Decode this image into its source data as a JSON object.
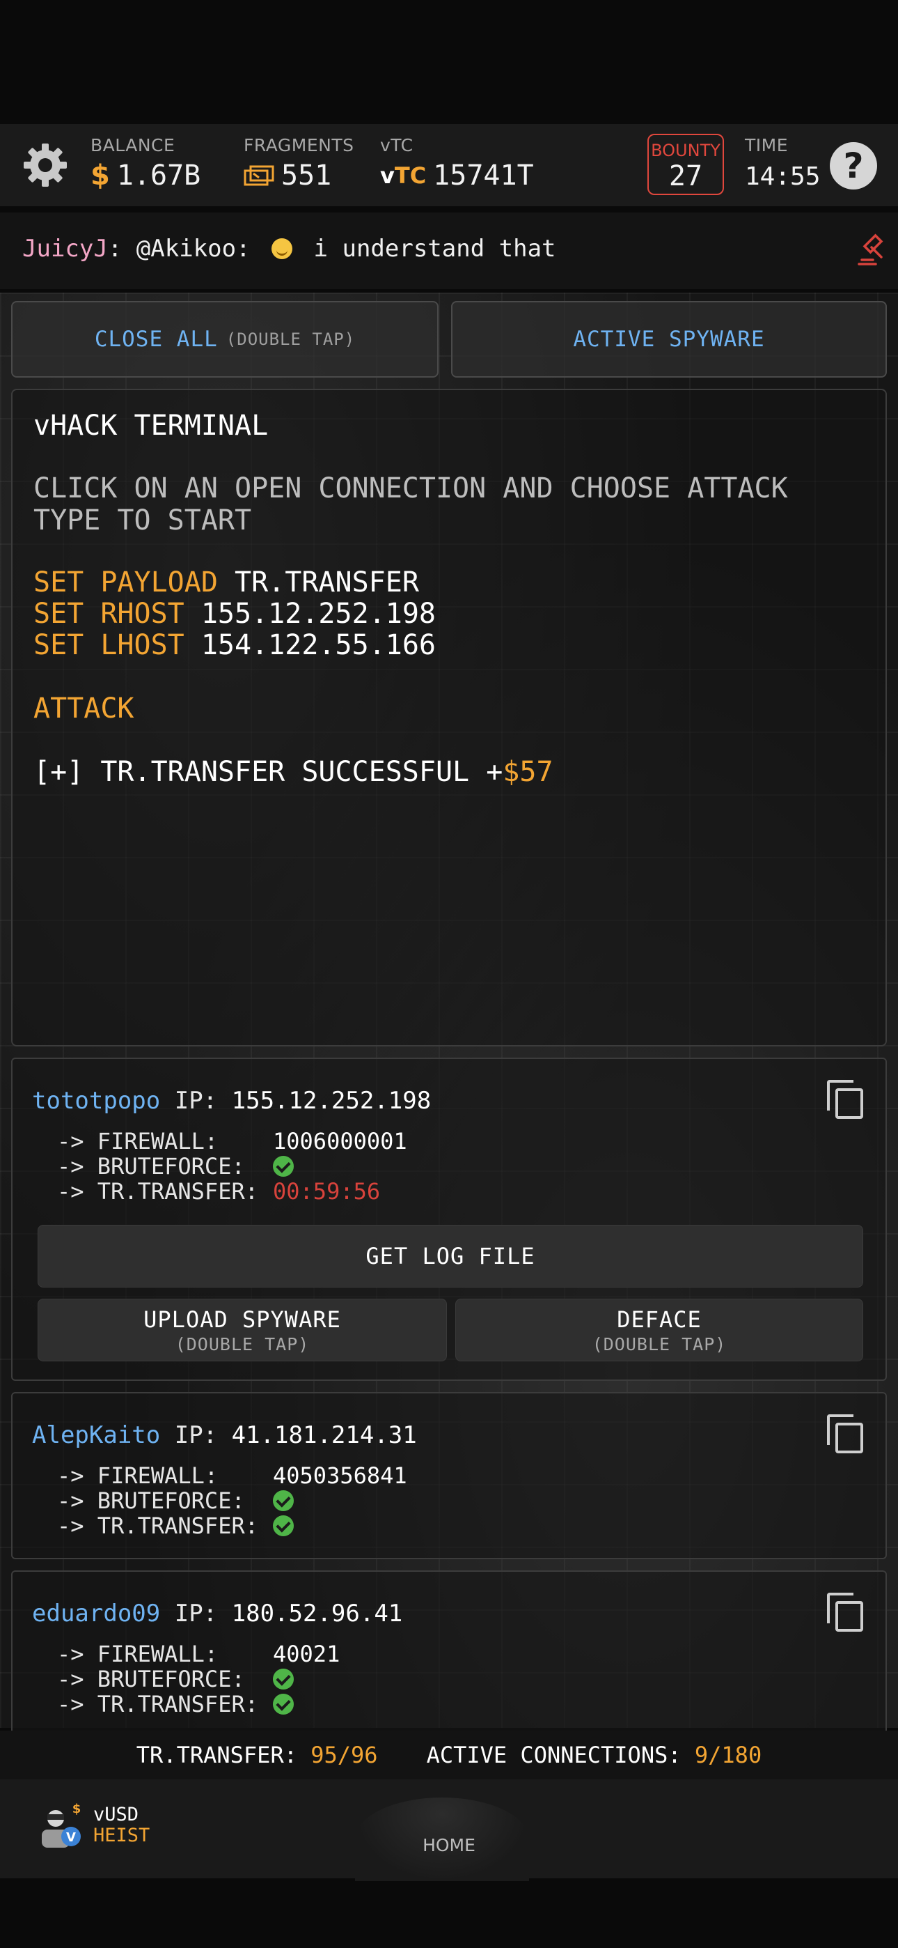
{
  "topbar": {
    "balance": {
      "label": "BALANCE",
      "currency_symbol": "$",
      "value": "1.67B"
    },
    "fragments": {
      "label": "FRAGMENTS",
      "value": "551"
    },
    "vtc": {
      "label": "vTC",
      "logo_v": "v",
      "logo_tc": "TC",
      "value": "15741T"
    },
    "bounty": {
      "label": "BOUNTY",
      "value": "27"
    },
    "time": {
      "label": "TIME",
      "value": "14:55"
    },
    "help_symbol": "?"
  },
  "chat": {
    "user": "JuicyJ",
    "separator": ":",
    "mention": "@Akikoo:",
    "message": "i understand that"
  },
  "buttons": {
    "close_all": "CLOSE ALL",
    "close_all_sub": "(DOUBLE TAP)",
    "active_spyware": "ACTIVE SPYWARE"
  },
  "terminal": {
    "title": "vHACK TERMINAL",
    "hint": "CLICK ON AN OPEN CONNECTION AND CHOOSE ATTACK TYPE TO START",
    "commands": [
      {
        "key": "SET PAYLOAD",
        "value": "TR.TRANSFER"
      },
      {
        "key": "SET RHOST",
        "value": "155.12.252.198"
      },
      {
        "key": "SET LHOST",
        "value": "154.122.55.166"
      }
    ],
    "attack": "ATTACK",
    "result_prefix": "[+] TR.TRANSFER SUCCESSFUL +",
    "result_amount": "$57"
  },
  "connections": [
    {
      "user": "tototpopo",
      "ip_label": "IP:",
      "ip": "155.12.252.198",
      "firewall_label": "-> FIREWALL:",
      "firewall": "1006000001",
      "bruteforce_label": "-> BRUTEFORCE:",
      "transfer_label": "-> TR.TRANSFER:",
      "transfer": "00:59:56",
      "get_log": "GET LOG FILE",
      "upload_spyware": "UPLOAD SPYWARE",
      "upload_sub": "(DOUBLE TAP)",
      "deface": "DEFACE",
      "deface_sub": "(DOUBLE TAP)"
    },
    {
      "user": "AlepKaito",
      "ip_label": "IP:",
      "ip": "41.181.214.31",
      "firewall_label": "-> FIREWALL:",
      "firewall": "4050356841",
      "bruteforce_label": "-> BRUTEFORCE:",
      "transfer_label": "-> TR.TRANSFER:"
    },
    {
      "user": "eduardo09",
      "ip_label": "IP:",
      "ip": "180.52.96.41",
      "firewall_label": "-> FIREWALL:",
      "firewall": "40021",
      "bruteforce_label": "-> BRUTEFORCE:",
      "transfer_label": "-> TR.TRANSFER:"
    }
  ],
  "status": {
    "transfer_label": "TR.TRANSFER:",
    "transfer_value": "95/96",
    "connections_label": "ACTIVE CONNECTIONS:",
    "connections_value": "9/180"
  },
  "nav": {
    "heist_line1": "vUSD",
    "heist_line2": "HEIST",
    "heist_icon_symbol": "$",
    "home": "HOME"
  },
  "colors": {
    "accent_gold": "#f3a533",
    "link_blue": "#6fb3f2",
    "alert_red": "#e0473d",
    "success_green": "#4fb548",
    "chat_user_pink": "#f3a6c6"
  }
}
